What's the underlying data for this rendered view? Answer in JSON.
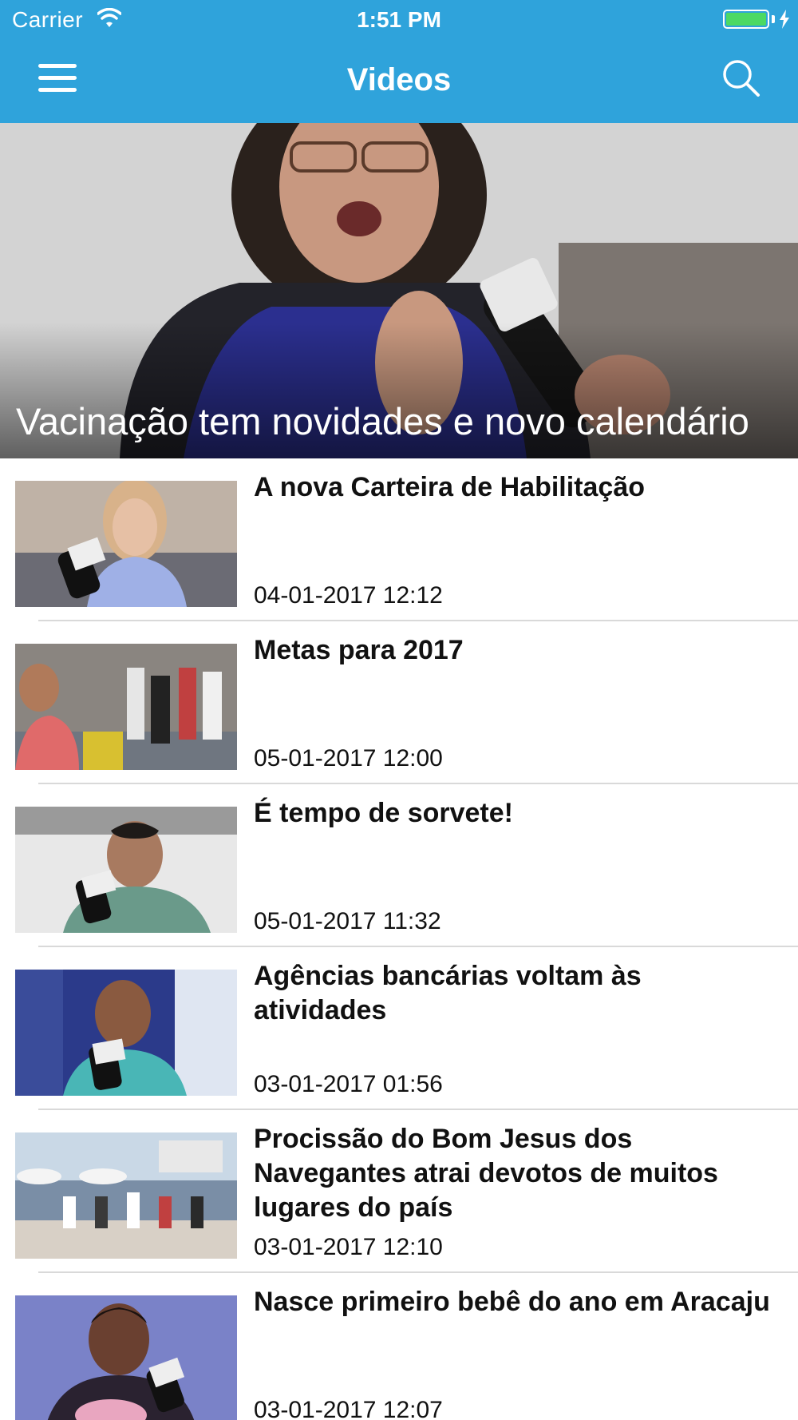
{
  "status_bar": {
    "carrier": "Carrier",
    "time": "1:51 PM",
    "battery_color": "#4cd964"
  },
  "nav": {
    "title": "Videos",
    "menu_icon": "hamburger-menu-icon",
    "search_icon": "search-icon",
    "bar_color": "#2fa3db"
  },
  "hero": {
    "title": "Vacinação tem novidades e novo calendário"
  },
  "videos": [
    {
      "title": "A nova Carteira de Habilitação",
      "date": "04-01-2017 12:12"
    },
    {
      "title": "Metas para 2017",
      "date": "05-01-2017 12:00"
    },
    {
      "title": "É tempo de sorvete!",
      "date": "05-01-2017 11:32"
    },
    {
      "title": "Agências bancárias voltam às atividades",
      "date": "03-01-2017 01:56"
    },
    {
      "title": "Procissão do Bom Jesus dos Navegantes atrai devotos de muitos lugares do país",
      "date": "03-01-2017 12:10"
    },
    {
      "title": "Nasce primeiro bebê do ano em Aracaju",
      "date": "03-01-2017 12:07"
    }
  ]
}
